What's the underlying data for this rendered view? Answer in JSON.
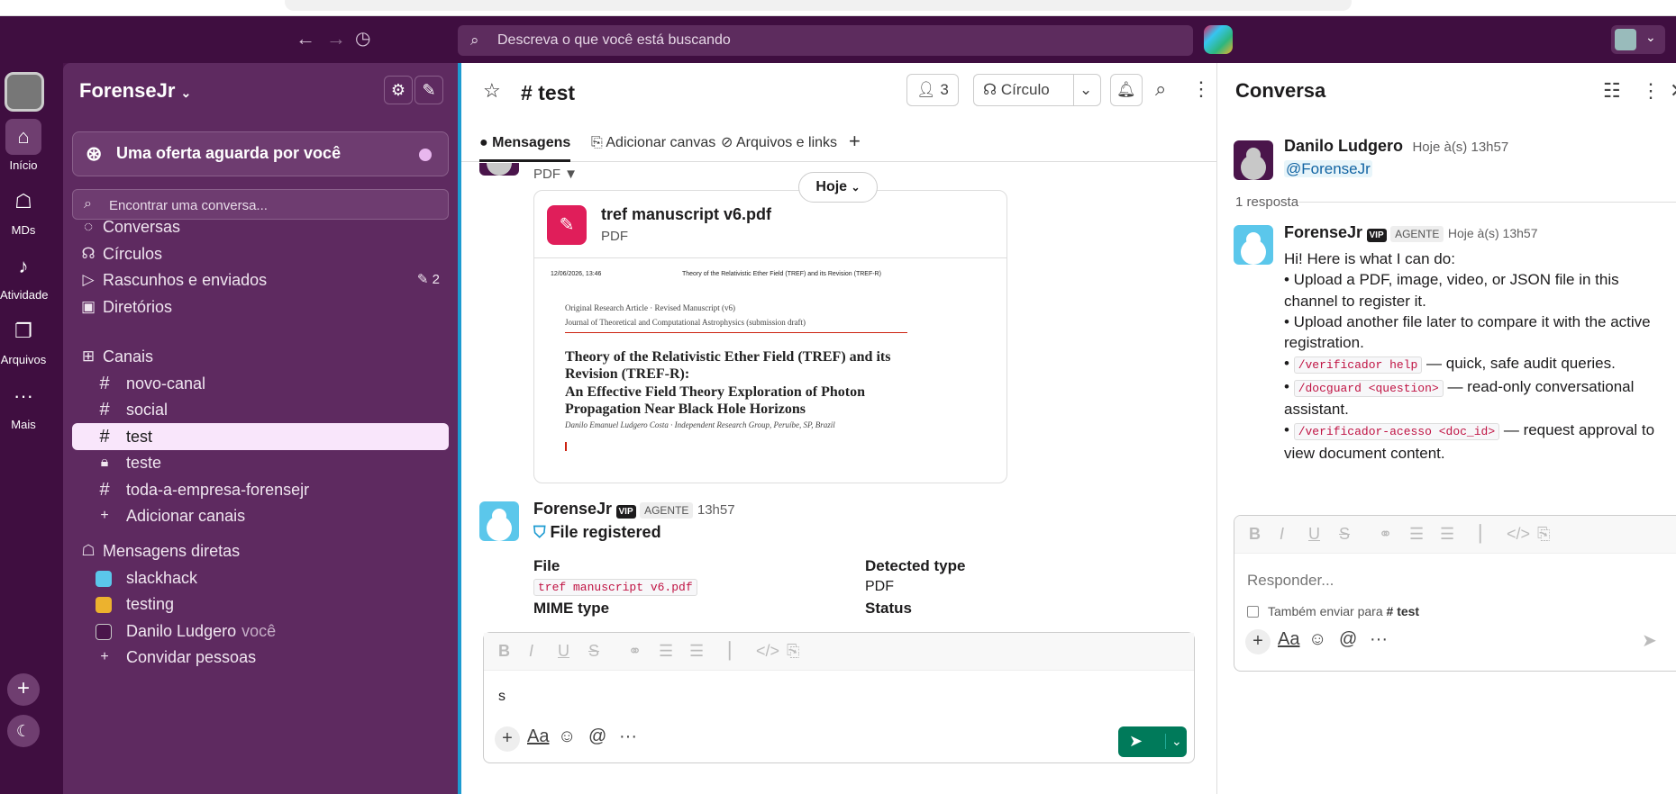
{
  "topbar": {
    "search_placeholder": "Descreva o que você está buscando",
    "back_icon": "arrow-left-icon",
    "forward_icon": "arrow-right-icon",
    "history_icon": "clock-icon"
  },
  "rail": {
    "items": [
      {
        "label": "Início",
        "icon": "home-icon"
      },
      {
        "label": "MDs",
        "icon": "chat-icon"
      },
      {
        "label": "Atividade",
        "icon": "bell-icon"
      },
      {
        "label": "Arquivos",
        "icon": "files-icon"
      },
      {
        "label": "Mais",
        "icon": "more-icon"
      }
    ]
  },
  "sidebar": {
    "workspace": "ForenseJr",
    "offer": "Uma oferta aguarda por você",
    "find_placeholder": "Encontrar uma conversa...",
    "nav": [
      {
        "label": "Conversas",
        "icon": "threads-icon"
      },
      {
        "label": "Círculos",
        "icon": "headphones-icon"
      },
      {
        "label": "Rascunhos e enviados",
        "icon": "send-icon",
        "count": "2"
      },
      {
        "label": "Diretórios",
        "icon": "directory-icon"
      }
    ],
    "channels_header": "Canais",
    "channels": [
      {
        "label": "novo-canal",
        "icon": "#"
      },
      {
        "label": "social",
        "icon": "#"
      },
      {
        "label": "test",
        "icon": "#",
        "active": true
      },
      {
        "label": "teste",
        "icon": "lock-icon"
      },
      {
        "label": "toda-a-empresa-forensejr",
        "icon": "#"
      }
    ],
    "add_channels": "Adicionar canais",
    "dm_header": "Mensagens diretas",
    "dms": [
      {
        "label": "slackhack",
        "color": "#5bc7eb"
      },
      {
        "label": "testing",
        "color": "#ecb22e"
      },
      {
        "label": "Danilo Ludgero",
        "you": "você",
        "color": "#4a154b"
      }
    ],
    "invite": "Convidar pessoas"
  },
  "channel": {
    "name": "# test",
    "members": "3",
    "huddle": "Círculo",
    "tabs": [
      "Mensagens",
      "Adicionar canvas",
      "Arquivos e links"
    ],
    "date_divider": "Hoje",
    "prev_file_type": "PDF",
    "file": {
      "name": "tref manuscript v6.pdf",
      "type": "PDF",
      "preview": {
        "header_left": "12/06/2026, 13:46",
        "header_center": "Theory of the Relativistic Ether Field (TREF) and its Revision (TREF-R)",
        "kicker1": "Original Research Article · Revised Manuscript (v6)",
        "kicker2": "Journal of Theoretical and Computational Astrophysics (submission draft)",
        "title": "Theory of the Relativistic Ether Field (TREF) and its Revision (TREF-R):",
        "subtitle": "An Effective Field Theory Exploration of Photon Propagation Near Black Hole Horizons",
        "author": "Danilo Emanuel Ludgero Costa · Independent Research Group, Peruíbe, SP, Brazil"
      }
    },
    "bot_msg": {
      "author": "ForenseJr",
      "vip": "VIP",
      "badge": "AGENTE",
      "time": "13h57",
      "title": "File registered",
      "shield_icon": "shield-icon",
      "col1_header": "File",
      "col1_value": "tref manuscript v6.pdf",
      "col1_next": "MIME type",
      "col2_header": "Detected type",
      "col2_value": "PDF",
      "col2_next": "Status"
    },
    "composer_text": "s"
  },
  "thread": {
    "title": "Conversa",
    "parent": {
      "author": "Danilo Ludgero",
      "time": "Hoje à(s) 13h57",
      "mention": "@ForenseJr"
    },
    "replies": "1 resposta",
    "reply": {
      "author": "ForenseJr",
      "vip": "VIP",
      "badge": "AGENTE",
      "time": "Hoje à(s) 13h57",
      "intro": "Hi! Here is what I can do:",
      "b1": "• Upload a PDF, image, video, or JSON file in this channel to register it.",
      "b2": "• Upload another file later to compare it with the active registration.",
      "b3_code": "/verificador help",
      "b3_text": " — quick, safe audit queries.",
      "b4_code": "/docguard <question>",
      "b4_text": " — read-only conversational assistant.",
      "b5_code": "/verificador-acesso <doc_id>",
      "b5_text": " — request approval to view document content."
    },
    "composer_placeholder": "Responder...",
    "also_send": "Também enviar para",
    "also_send_channel": "# test"
  },
  "colors": {
    "aubergine": "#4a154b",
    "sidebar": "#5e2a60",
    "accent": "#1d9bd1",
    "send": "#007a5a"
  }
}
